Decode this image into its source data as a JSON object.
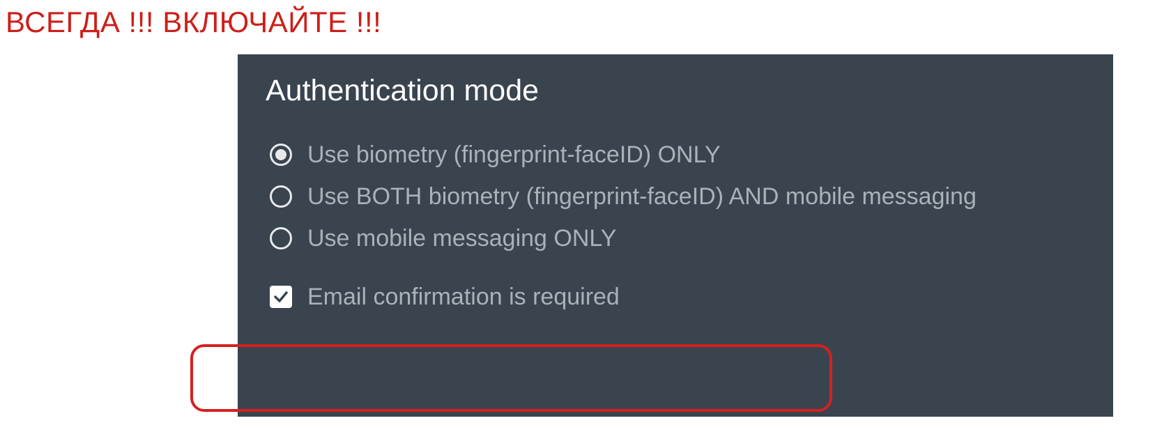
{
  "warning": "ВСЕГДА !!! ВКЛЮЧАЙТЕ !!!",
  "panel": {
    "title": "Authentication mode",
    "options": [
      {
        "label": "Use biometry (fingerprint-faceID) ONLY",
        "checked": true
      },
      {
        "label": "Use BOTH biometry (fingerprint-faceID) AND mobile messaging",
        "checked": false
      },
      {
        "label": "Use mobile messaging ONLY",
        "checked": false
      }
    ],
    "email_confirmation": {
      "label": "Email confirmation is required",
      "checked": true
    }
  }
}
